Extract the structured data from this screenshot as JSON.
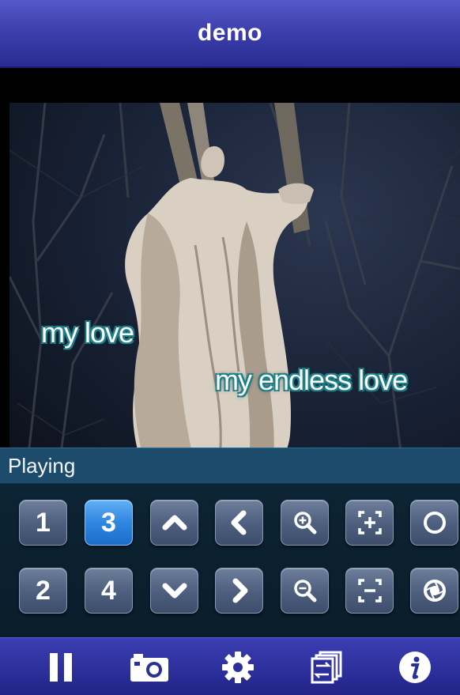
{
  "header": {
    "title": "demo"
  },
  "video": {
    "captions": [
      "my love",
      "my endless love"
    ]
  },
  "status": {
    "text": "Playing"
  },
  "controls": {
    "channel_1": "1",
    "channel_2": "2",
    "channel_3": "3",
    "channel_4": "4",
    "selected_channel": "3"
  },
  "icons": {
    "up": "chevron-up-icon",
    "down": "chevron-down-icon",
    "left": "chevron-left-icon",
    "right": "chevron-right-icon",
    "zoom_in": "zoom-in-icon",
    "zoom_out": "zoom-out-icon",
    "focus_in": "focus-in-icon",
    "focus_out": "focus-out-icon",
    "iris_open": "iris-open-icon",
    "iris_close": "iris-close-icon",
    "pause": "pause-icon",
    "snapshot": "camera-icon",
    "settings": "gear-icon",
    "switch_view": "switch-view-icon",
    "info": "info-icon"
  },
  "colors": {
    "title_bar": "#3d40ad",
    "status_bar": "#1d4b6c",
    "button": "#4f6080",
    "button_active": "#2f86e0",
    "tab_bar": "#2c2e9a"
  }
}
